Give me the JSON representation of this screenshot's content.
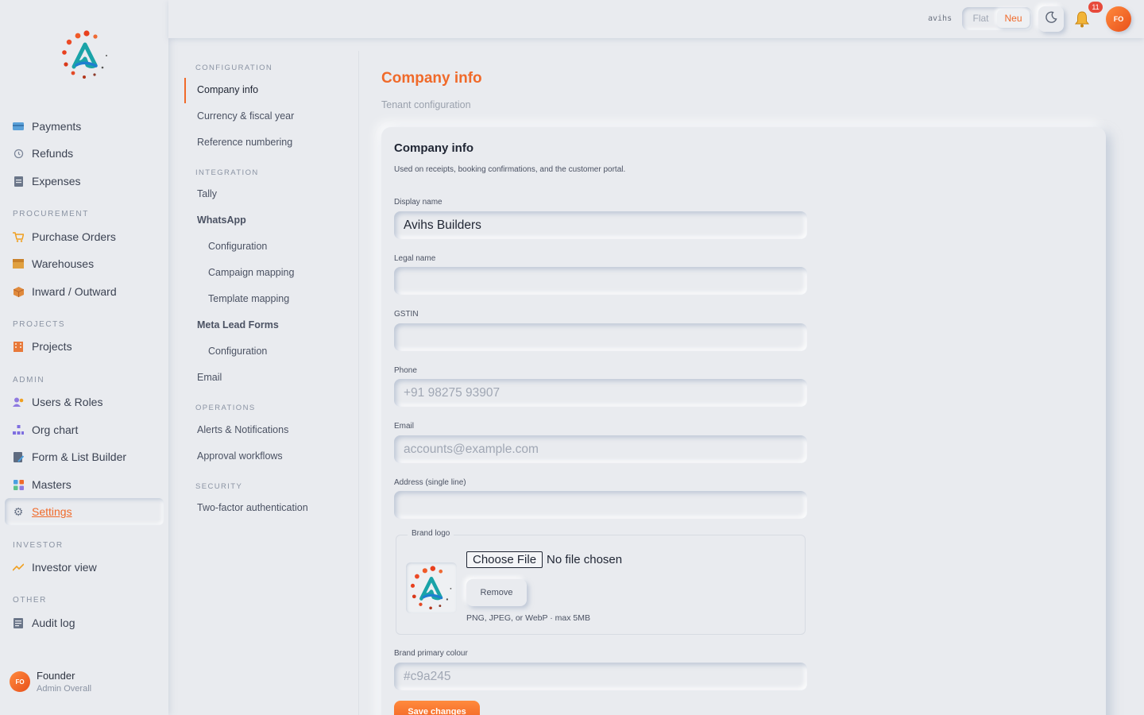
{
  "sidebar": {
    "groups": {
      "procurement": "PROCUREMENT",
      "projects": "PROJECTS",
      "admin": "ADMIN",
      "investor": "INVESTOR",
      "other": "OTHER"
    },
    "items": {
      "payments": "Payments",
      "refunds": "Refunds",
      "expenses": "Expenses",
      "purchase_orders": "Purchase Orders",
      "warehouses": "Warehouses",
      "inward_outward": "Inward / Outward",
      "projects": "Projects",
      "users_roles": "Users & Roles",
      "org_chart": "Org chart",
      "form_list_builder": "Form & List Builder",
      "masters": "Masters",
      "settings": "Settings",
      "investor_view": "Investor view",
      "audit_log": "Audit log"
    },
    "user": {
      "initials": "FO",
      "name": "Founder",
      "role": "Admin Overall"
    }
  },
  "topbar": {
    "tenant": "avihs",
    "theme_toggle": {
      "flat": "Flat",
      "neu": "Neu",
      "selected": "Neu"
    },
    "notification_count": "11",
    "avatar_initials": "FO"
  },
  "subnav": {
    "groups": {
      "configuration": "CONFIGURATION",
      "integration": "INTEGRATION",
      "operations": "OPERATIONS",
      "security": "SECURITY"
    },
    "items": {
      "company_info": "Company info",
      "currency": "Currency & fiscal year",
      "reference": "Reference numbering",
      "tally": "Tally",
      "whatsapp": "WhatsApp",
      "wa_config": "Configuration",
      "wa_campaign": "Campaign mapping",
      "wa_template": "Template mapping",
      "meta_lead": "Meta Lead Forms",
      "meta_config": "Configuration",
      "email": "Email",
      "alerts": "Alerts & Notifications",
      "approval": "Approval workflows",
      "two_factor": "Two-factor authentication"
    }
  },
  "page": {
    "title": "Company info",
    "subtitle": "Tenant configuration"
  },
  "form": {
    "title": "Company info",
    "description": "Used on receipts, booking confirmations, and the customer portal.",
    "display_name": {
      "label": "Display name",
      "value": "Avihs Builders"
    },
    "legal_name": {
      "label": "Legal name",
      "value": ""
    },
    "gstin": {
      "label": "GSTIN",
      "value": ""
    },
    "phone": {
      "label": "Phone",
      "placeholder": "+91 98275 93907"
    },
    "email": {
      "label": "Email",
      "placeholder": "accounts@example.com"
    },
    "address": {
      "label": "Address (single line)",
      "value": ""
    },
    "brand_logo": {
      "legend": "Brand logo",
      "choose_label": "Choose File",
      "no_file": "No file chosen",
      "remove_label": "Remove",
      "hint": "PNG, JPEG, or WebP · max 5MB"
    },
    "brand_colour": {
      "label": "Brand primary colour",
      "placeholder": "#c9a245"
    },
    "save_label": "Save changes"
  },
  "colors": {
    "accent": "#f06a2a",
    "background": "#e9ebef",
    "badge": "#e74a3b"
  }
}
